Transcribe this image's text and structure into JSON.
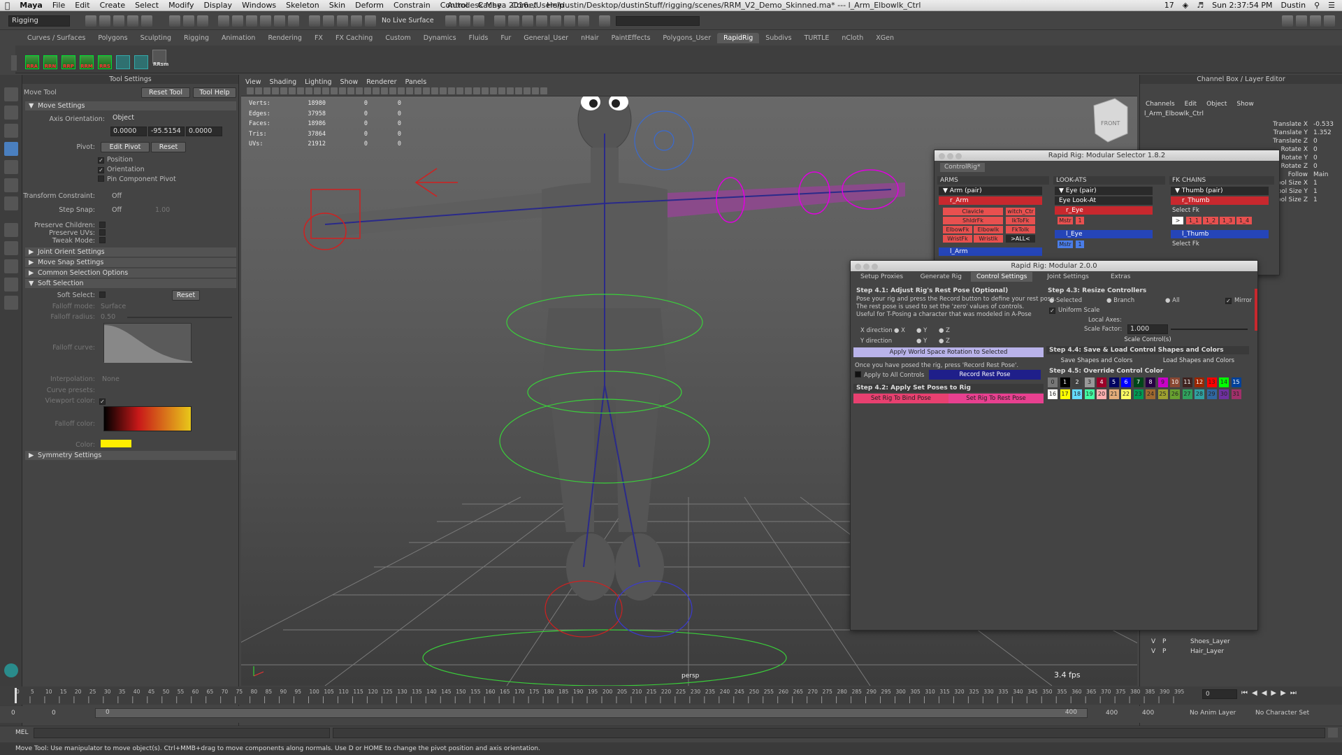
{
  "macbar": {
    "apple": "",
    "app": "Maya",
    "menus": [
      "File",
      "Edit",
      "Create",
      "Select",
      "Modify",
      "Display",
      "Windows",
      "Skeleton",
      "Skin",
      "Deform",
      "Constrain",
      "Control",
      "Cache",
      "Comet",
      "Help"
    ],
    "window_title": "Autodesk Maya 2016: /Users/dustin/Desktop/dustinStuff/rigging/scenes/RRM_V2_Demo_Skinned.ma*   ---   l_Arm_Elbowlk_Ctrl",
    "clock": "Sun 2:37:54 PM",
    "user": "Dustin",
    "status_num": "17"
  },
  "statusline": {
    "menuset": "Rigging",
    "live_surface": "No Live Surface"
  },
  "shelf": {
    "tabs": [
      "Curves / Surfaces",
      "Polygons",
      "Sculpting",
      "Rigging",
      "Animation",
      "Rendering",
      "FX",
      "FX Caching",
      "Custom",
      "Dynamics",
      "Fluids",
      "Fur",
      "General_User",
      "nHair",
      "PaintEffects",
      "Polygons_User",
      "RapidRig",
      "Subdivs",
      "TURTLE",
      "nCloth",
      "XGen"
    ],
    "active_tab": "RapidRig",
    "icons": [
      "RRA",
      "RRN",
      "RRP",
      "RRM",
      "RRS",
      "",
      "",
      "RRsm"
    ]
  },
  "tool_settings": {
    "panel_title": "Tool Settings",
    "tool_name": "Move Tool",
    "reset_tool": "Reset Tool",
    "tool_help": "Tool Help",
    "move_settings": "Move Settings",
    "axis_orientation_label": "Axis Orientation:",
    "axis_orientation": "Object",
    "axis_values": [
      "0.0000",
      "-95.5154",
      "0.0000"
    ],
    "pivot_label": "Pivot:",
    "edit_pivot": "Edit Pivot",
    "reset": "Reset",
    "position": "Position",
    "orientation": "Orientation",
    "pin_component_pivot": "Pin Component Pivot",
    "transform_constraint_label": "Transform Constraint:",
    "transform_constraint": "Off",
    "step_snap_label": "Step Snap:",
    "step_snap": "Off",
    "step_snap_value": "1.00",
    "preserve_children": "Preserve Children:",
    "preserve_uvs": "Preserve UVs:",
    "tweak_mode": "Tweak Mode:",
    "joint_orient_settings": "Joint Orient Settings",
    "move_snap_settings": "Move Snap Settings",
    "common_selection_options": "Common Selection Options",
    "soft_selection": "Soft Selection",
    "soft_select_label": "Soft Select:",
    "soft_reset": "Reset",
    "falloff_mode_label": "Falloff mode:",
    "falloff_mode": "Surface",
    "falloff_radius_label": "Falloff radius:",
    "falloff_radius": "0.50",
    "falloff_curve_label": "Falloff curve:",
    "interpolation_label": "Interpolation:",
    "interpolation": "None",
    "curve_presets_label": "Curve presets:",
    "viewport_color_label": "Viewport color:",
    "falloff_color_label": "Falloff color:",
    "color_label": "Color:",
    "symmetry_settings": "Symmetry Settings"
  },
  "viewport": {
    "menus": [
      "View",
      "Shading",
      "Lighting",
      "Show",
      "Renderer",
      "Panels"
    ],
    "stats": [
      {
        "label": "Verts:",
        "v": "18980",
        "a": "0",
        "b": "0"
      },
      {
        "label": "Edges:",
        "v": "37958",
        "a": "0",
        "b": "0"
      },
      {
        "label": "Faces:",
        "v": "18986",
        "a": "0",
        "b": "0"
      },
      {
        "label": "Tris:",
        "v": "37864",
        "a": "0",
        "b": "0"
      },
      {
        "label": "UVs:",
        "v": "21912",
        "a": "0",
        "b": "0"
      }
    ],
    "fps": "3.4 fps",
    "view_cube": "FRONT",
    "persp": "persp"
  },
  "channel_box": {
    "title": "Channel Box / Layer Editor",
    "menus": [
      "Channels",
      "Edit",
      "Object",
      "Show"
    ],
    "object": "l_Arm_Elbowlk_Ctrl",
    "attrs": [
      {
        "name": "Translate X",
        "value": "-0.533"
      },
      {
        "name": "Translate Y",
        "value": "1.352"
      },
      {
        "name": "Translate Z",
        "value": "0"
      },
      {
        "name": "Rotate X",
        "value": "0"
      },
      {
        "name": "Rotate Y",
        "value": "0"
      },
      {
        "name": "Rotate Z",
        "value": "0"
      },
      {
        "name": "Follow",
        "value": "Main"
      },
      {
        "name": "pol Size X",
        "value": "1"
      },
      {
        "name": "pol Size Y",
        "value": "1"
      },
      {
        "name": "pol Size Z",
        "value": "1"
      }
    ],
    "layers": [
      {
        "v": "V",
        "p": "P",
        "name": "Shoes_Layer"
      },
      {
        "v": "V",
        "p": "P",
        "name": "Hair_Layer"
      }
    ]
  },
  "selector": {
    "title": "Rapid Rig: Modular Selector 1.8.2",
    "tab": "ControlRig*",
    "arms_header": "ARMS",
    "arm_pair": "Arm (pair)",
    "r_arm": "r_Arm",
    "r_arm_buttons": [
      "Clavicle",
      "ShldrFk",
      "ElbowFk",
      "WristFk"
    ],
    "r_arm_buttons2": [
      "",
      "Elbowlk",
      "Wristlk"
    ],
    "r_arm_buttons3": [
      "witch_Ctr",
      "IkToFk",
      "FkToIk",
      ">ALL<"
    ],
    "l_arm": "l_Arm",
    "lookats_header": "LOOK-ATS",
    "eye_pair": "Eye (pair)",
    "eye_lookat": "Eye Look-At",
    "r_eye": "r_Eye",
    "mstr": "Mstr",
    "one": "1",
    "l_eye": "l_Eye",
    "fk_header": "FK CHAINS",
    "thumb_pair": "Thumb (pair)",
    "r_thumb": "r_Thumb",
    "select_fk": "Select Fk",
    "thumb_nums": [
      ">",
      "1_1",
      "1_2",
      "1_3",
      "1_4"
    ],
    "l_thumb": "l_Thumb"
  },
  "modular": {
    "title": "Rapid Rig: Modular 2.0.0",
    "tabs": [
      "Setup Proxies",
      "Generate Rig",
      "Control Settings",
      "Joint Settings",
      "Extras"
    ],
    "active_tab": "Control Settings",
    "step41": "Step 4.1: Adjust Rig's Rest Pose (Optional)",
    "step41_text": [
      "Pose your rig and press the Record button to define your rest pose.",
      "The rest pose is used to set the 'zero' values of controls.",
      "Useful for T-Posing a character that was modeled in A-Pose"
    ],
    "x_direction": "X direction",
    "y_direction": "Y direction",
    "axes": [
      "X",
      "Y",
      "Z"
    ],
    "apply_world": "Apply World Space Rotation to Selected",
    "once_text": "Once you have posed the rig, press 'Record Rest Pose'.",
    "apply_all": "Apply to All Controls",
    "record_rest": "Record Rest Pose",
    "step42": "Step 4.2: Apply Set Poses to Rig",
    "set_bind": "Set Rig To Bind Pose",
    "set_rest": "Set Rig To Rest Pose",
    "step43": "Step 4.3: Resize Controllers",
    "selected": "Selected",
    "branch": "Branch",
    "all": "All",
    "mirror": "Mirror",
    "uniform_scale": "Uniform Scale",
    "local_axes": "Local Axes:",
    "scale_factor": "Scale Factor:",
    "scale_value": "1.000",
    "scale_controls": "Scale Control(s)",
    "step44": "Step 4.4: Save & Load Control Shapes and Colors",
    "save_shapes": "Save Shapes and Colors",
    "load_shapes": "Load Shapes and Colors",
    "step45": "Step 4.5: Override Control Color",
    "palette_row1": [
      {
        "n": "0",
        "c": "#777777"
      },
      {
        "n": "1",
        "c": "#000000"
      },
      {
        "n": "2",
        "c": "#404040"
      },
      {
        "n": "3",
        "c": "#999999"
      },
      {
        "n": "4",
        "c": "#9b0028"
      },
      {
        "n": "5",
        "c": "#000460"
      },
      {
        "n": "6",
        "c": "#0000ff"
      },
      {
        "n": "7",
        "c": "#004619"
      },
      {
        "n": "8",
        "c": "#260043"
      },
      {
        "n": "9",
        "c": "#c800c8"
      },
      {
        "n": "10",
        "c": "#8a4833"
      },
      {
        "n": "11",
        "c": "#3f231f"
      },
      {
        "n": "12",
        "c": "#992600"
      },
      {
        "n": "13",
        "c": "#ff0000"
      },
      {
        "n": "14",
        "c": "#00ff00"
      },
      {
        "n": "15",
        "c": "#004199"
      }
    ],
    "palette_row2": [
      {
        "n": "16",
        "c": "#ffffff"
      },
      {
        "n": "17",
        "c": "#ffff00"
      },
      {
        "n": "18",
        "c": "#64dcff"
      },
      {
        "n": "19",
        "c": "#43ffa3"
      },
      {
        "n": "20",
        "c": "#ffb0b0"
      },
      {
        "n": "21",
        "c": "#e4ac79"
      },
      {
        "n": "22",
        "c": "#ffff63"
      },
      {
        "n": "23",
        "c": "#009954"
      },
      {
        "n": "24",
        "c": "#a16a30"
      },
      {
        "n": "25",
        "c": "#9ea130"
      },
      {
        "n": "26",
        "c": "#68a130"
      },
      {
        "n": "27",
        "c": "#30a15d"
      },
      {
        "n": "28",
        "c": "#30a1a1"
      },
      {
        "n": "29",
        "c": "#3067a1"
      },
      {
        "n": "30",
        "c": "#6f30a1"
      },
      {
        "n": "31",
        "c": "#a1306a"
      }
    ]
  },
  "timeline": {
    "ticks": [
      "0",
      "5",
      "10",
      "15",
      "20",
      "25",
      "30",
      "35",
      "40",
      "45",
      "50",
      "55",
      "60",
      "65",
      "70",
      "75",
      "80",
      "85",
      "90",
      "95",
      "100",
      "105",
      "110",
      "115",
      "120",
      "125",
      "130",
      "135",
      "140",
      "145",
      "150",
      "155",
      "160",
      "165",
      "170",
      "175",
      "180",
      "185",
      "190",
      "195",
      "200",
      "205",
      "210",
      "215",
      "220",
      "225",
      "230",
      "235",
      "240",
      "245",
      "250",
      "255",
      "260",
      "265",
      "270",
      "275",
      "280",
      "285",
      "290",
      "295",
      "300",
      "305",
      "310",
      "315",
      "320",
      "325",
      "330",
      "335",
      "340",
      "345",
      "350",
      "355",
      "360",
      "365",
      "370",
      "375",
      "380",
      "385",
      "390",
      "395"
    ],
    "current": "0",
    "range_start": "0",
    "range_start2": "0",
    "range_inner": "0",
    "range_end": "400",
    "range_end2": "400",
    "range_end3": "400",
    "anim_layer": "No Anim Layer",
    "char_set": "No Character Set"
  },
  "cmdline": {
    "mel": "MEL"
  },
  "help": {
    "text": "Move Tool: Use manipulator to move object(s). Ctrl+MMB+drag to move components along normals. Use D or HOME to change the pivot position and axis orientation."
  }
}
